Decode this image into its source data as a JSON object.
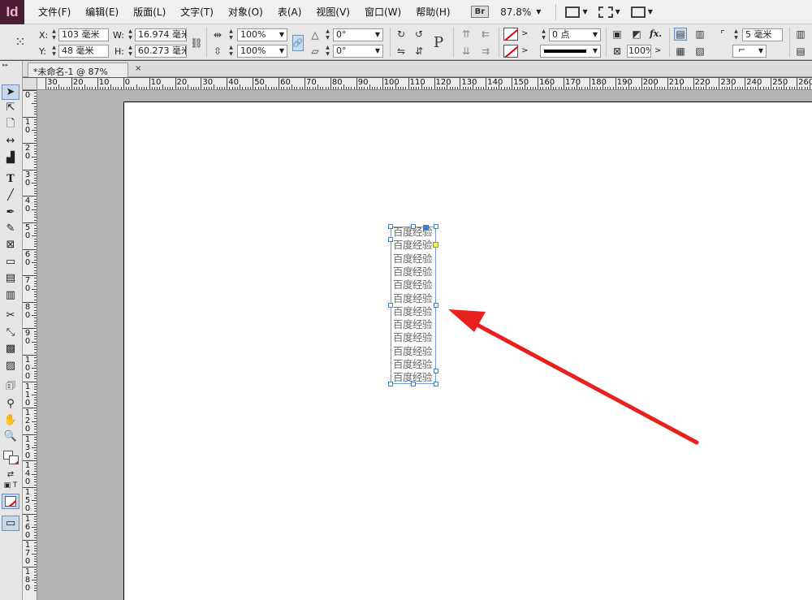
{
  "app": {
    "logo": "Id"
  },
  "menu": [
    "文件(F)",
    "编辑(E)",
    "版面(L)",
    "文字(T)",
    "对象(O)",
    "表(A)",
    "视图(V)",
    "窗口(W)",
    "帮助(H)"
  ],
  "menubar": {
    "bridge_badge": "Br",
    "zoom": "87.8%",
    "zoom_caret": "▼"
  },
  "control": {
    "x_label": "X:",
    "x_value": "103 毫米",
    "y_label": "Y:",
    "y_value": "48 毫米",
    "w_label": "W:",
    "w_value": "16.974 毫米",
    "h_label": "H:",
    "h_value": "60.273 毫米",
    "scale_x": "100%",
    "scale_y": "100%",
    "rotate": "0°",
    "shear": "0°",
    "stroke_weight": "0 点",
    "opacity": "100%",
    "frame_offset": "5 毫米",
    "p_glyph": "P",
    "fx_label": "fx."
  },
  "tab": {
    "title": "*未命名-1 @ 87%",
    "close": "×"
  },
  "ruler_h_labels": [
    "30",
    "20",
    "10",
    "0",
    "10",
    "20",
    "30",
    "40",
    "50",
    "60",
    "70",
    "80",
    "90",
    "100",
    "110",
    "120",
    "130",
    "140",
    "150",
    "160",
    "170",
    "180",
    "190",
    "200",
    "210",
    "220",
    "230",
    "240",
    "250",
    "260"
  ],
  "ruler_v_labels": [
    "0",
    "10",
    "20",
    "30",
    "40",
    "50",
    "60",
    "70",
    "80",
    "90",
    "100",
    "110",
    "120",
    "130",
    "140",
    "150",
    "160",
    "170",
    "180"
  ],
  "text_frame": {
    "lines": [
      "百度经验",
      "百度经验",
      "百度经验",
      "百度经验",
      "百度经验",
      "百度经验",
      "百度经验",
      "百度经验",
      "百度经验",
      "百度经验",
      "百度经验",
      "百度经验"
    ]
  },
  "colors": {
    "arrow": "#e8201e",
    "selection": "#3d7ed6",
    "page": "#ffffff",
    "pasteboard": "#b5b5b5"
  },
  "tools": [
    "selection-tool-icon",
    "direct-selection-tool-icon",
    "page-tool-icon",
    "gap-tool-icon",
    "content-collector-icon",
    "type-tool-icon",
    "line-tool-icon",
    "pen-tool-icon",
    "pencil-tool-icon",
    "rectangle-frame-tool-icon",
    "rectangle-tool-icon",
    "horizontal-grid-tool-icon",
    "vertical-grid-tool-icon",
    "scissors-tool-icon",
    "free-transform-tool-icon",
    "gradient-swatch-tool-icon",
    "gradient-feather-tool-icon",
    "note-tool-icon",
    "eyedropper-tool-icon",
    "hand-tool-icon",
    "zoom-tool-icon",
    "fill-stroke-icon",
    "swap-colors-icon",
    "formatting-affects-icon",
    "apply-none-icon",
    "screen-mode-icon"
  ]
}
